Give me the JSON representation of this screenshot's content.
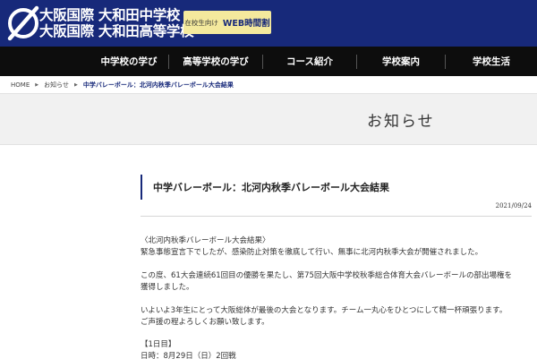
{
  "header": {
    "logo_line1": "大阪国際 大和田中学校",
    "logo_line2": "大阪国際 大和田高等学校",
    "web_button_small": "在校生向け",
    "web_button_big": "WEB時間割"
  },
  "nav": {
    "items": [
      "中学校の学び",
      "高等学校の学び",
      "コース紹介",
      "学校案内",
      "学校生活"
    ]
  },
  "breadcrumb": {
    "home": "HOME",
    "news": "お知らせ",
    "current": "中学バレーボール：北河内秋季バレーボール大会結果"
  },
  "banner": {
    "title": "お知らせ"
  },
  "article": {
    "title": "中学バレーボール：北河内秋季バレーボール大会結果",
    "date": "2021/09/24",
    "paragraphs": [
      "〈北河内秋季バレーボール大会結果〉",
      "緊急事態宣言下でしたが、感染防止対策を徹底して行い、無事に北河内秋季大会が開催されました。",
      "この度、61大会連続61回目の優勝を果たし、第75回大阪中学校秋季総合体育大会バレーボールの部出場権を",
      "獲得しました。",
      "いよいよ3年生にとって大阪総体が最後の大会となります。チーム一丸心をひとつにして精一杯頑張ります。",
      "ご声援の程よろしくお願い致します。",
      "【1日目】",
      "日時：8月29日（日）2回戦"
    ]
  }
}
